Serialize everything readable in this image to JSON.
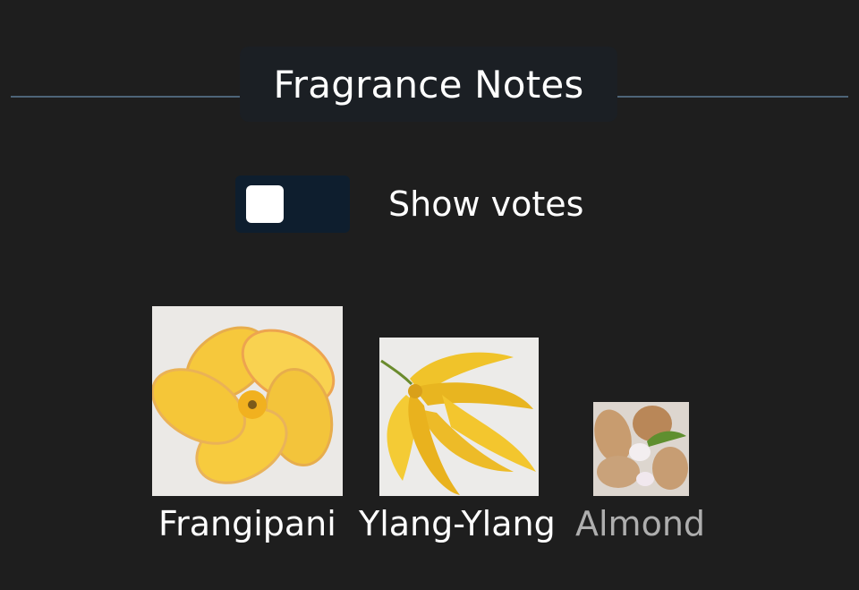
{
  "header": {
    "title": "Fragrance Notes"
  },
  "toggle": {
    "label": "Show votes",
    "checked": false
  },
  "notes": [
    {
      "name": "Frangipani",
      "icon": "frangipani-flower-image",
      "prominence": "large"
    },
    {
      "name": "Ylang-Ylang",
      "icon": "ylang-ylang-flower-image",
      "prominence": "medium"
    },
    {
      "name": "Almond",
      "icon": "almond-nut-image",
      "prominence": "small"
    }
  ],
  "colors": {
    "background": "#1e1e1e",
    "divider": "#4d6478",
    "title_pill": "#1b1f24",
    "toggle_track": "#0e1e2e",
    "muted_label": "#aeaeae"
  }
}
